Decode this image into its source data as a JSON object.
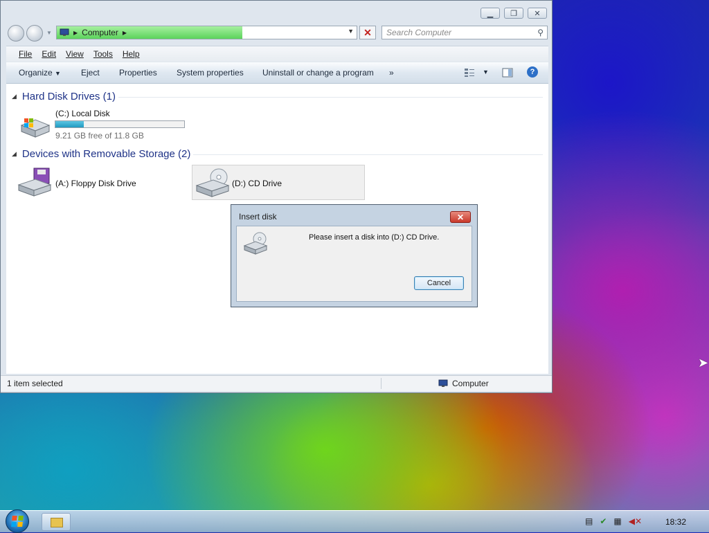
{
  "window": {
    "address": {
      "crumbs": [
        "Computer"
      ],
      "progress_percent": 62
    },
    "search": {
      "placeholder": "Search Computer"
    },
    "menu": [
      "File",
      "Edit",
      "View",
      "Tools",
      "Help"
    ],
    "commands": {
      "organize": "Organize",
      "eject": "Eject",
      "properties": "Properties",
      "system_properties": "System properties",
      "uninstall": "Uninstall or change a program",
      "more": "»"
    },
    "groups": [
      {
        "header": "Hard Disk Drives (1)",
        "items": [
          {
            "name": "(C:) Local Disk",
            "free_text": "9.21 GB free of 11.8 GB",
            "used_fraction": 0.22,
            "icon": "hard-drive-icon"
          }
        ]
      },
      {
        "header": "Devices with Removable Storage (2)",
        "items": [
          {
            "name": "(A:) Floppy Disk Drive",
            "icon": "floppy-drive-icon"
          },
          {
            "name": "(D:) CD Drive",
            "icon": "cd-drive-icon",
            "selected": true
          }
        ]
      }
    ],
    "status": {
      "left": "1 item selected",
      "right": "Computer"
    }
  },
  "dialog": {
    "title": "Insert disk",
    "message": "Please insert a disk into (D:) CD Drive.",
    "cancel": "Cancel"
  },
  "taskbar": {
    "clock": "18:32"
  }
}
